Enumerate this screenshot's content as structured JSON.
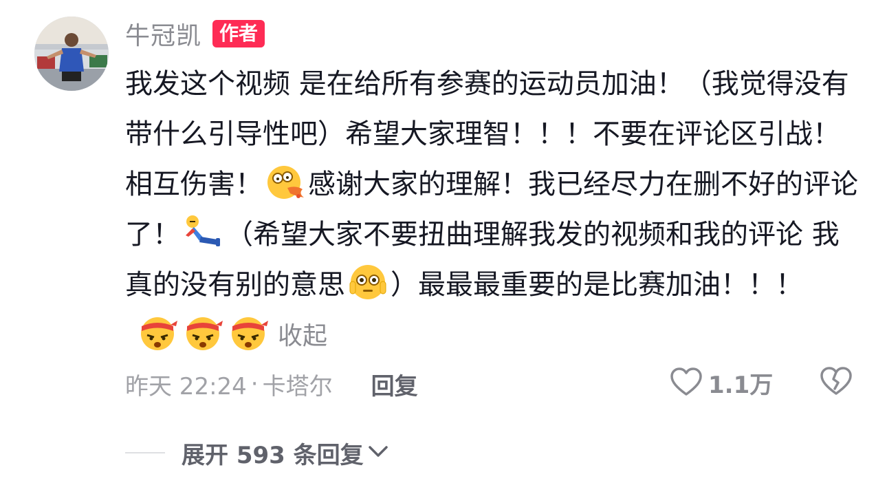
{
  "comment": {
    "author": {
      "name": "牛冠凯",
      "badge": "作者"
    },
    "text": {
      "part1": "我发这个视频 是在给所有参赛的运动员加油！（我觉得没有带什么引导性吧）希望大家理智！！！不要在评论区引战！相互伤害！",
      "part2": "感谢大家的理解！我已经尽力在删不好的评论了！",
      "part3": "（希望大家不要扭曲理解我发的视频和我的评论 我真的没有别的意思",
      "part4": "）最最最重要的是比赛加油！！！"
    },
    "emojis": {
      "after_part1": "puking-emoji",
      "after_part2": "fallen-person-emoji",
      "after_part3": "flushed-face-emoji",
      "trailing": [
        "headband-fighting-emoji",
        "headband-fighting-emoji",
        "headband-fighting-emoji"
      ]
    },
    "collapse_label": "收起",
    "time": "昨天 22:24",
    "separator": "·",
    "location": "卡塔尔",
    "reply_label": "回复",
    "like_count": "1.1万",
    "icons": {
      "like": "heart-outline-icon",
      "dislike": "broken-heart-icon",
      "expand": "chevron-down-icon"
    }
  },
  "replies": {
    "expand_label": "展开 593 条回复"
  },
  "colors": {
    "badge_bg": "#fe2c55",
    "text_primary": "#161823",
    "text_secondary": "#8a8b91",
    "emoji_yellow": "#ffc83d"
  }
}
